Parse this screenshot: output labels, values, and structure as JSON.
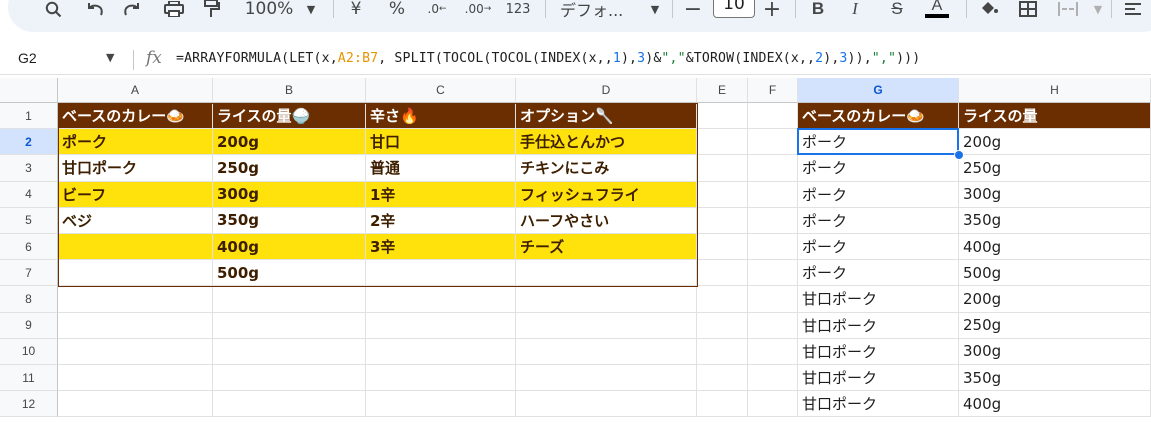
{
  "toolbar": {
    "zoom": "100%",
    "currency": "¥",
    "percent": "%",
    "decrease_decimals": ".0",
    "increase_decimals": ".00",
    "number_format": "123",
    "font_name": "デフォ...",
    "font_size": "10",
    "minus": "−",
    "plus": "+",
    "bold": "B",
    "italic": "I",
    "strikethrough": "S",
    "text_color": "A"
  },
  "formula_bar": {
    "cell_ref": "G2",
    "fx": "fx",
    "formula_parts": [
      {
        "text": "=ARRAYFORMULA(LET(x,",
        "kind": "plain"
      },
      {
        "text": "A2:B7",
        "kind": "ref"
      },
      {
        "text": ", SPLIT(TOCOL(TOCOL(INDEX(x,,",
        "kind": "plain"
      },
      {
        "text": "1",
        "kind": "num"
      },
      {
        "text": "),",
        "kind": "plain"
      },
      {
        "text": "3",
        "kind": "num"
      },
      {
        "text": ")&",
        "kind": "plain"
      },
      {
        "text": "\",\"",
        "kind": "str"
      },
      {
        "text": "&TOROW(INDEX(x,,",
        "kind": "plain"
      },
      {
        "text": "2",
        "kind": "num"
      },
      {
        "text": "),",
        "kind": "plain"
      },
      {
        "text": "3",
        "kind": "num"
      },
      {
        "text": ")),",
        "kind": "plain"
      },
      {
        "text": "\",\"",
        "kind": "str"
      },
      {
        "text": ")))",
        "kind": "plain"
      }
    ]
  },
  "columns": [
    "A",
    "B",
    "C",
    "D",
    "E",
    "F",
    "G",
    "H"
  ],
  "selected_column": "G",
  "rows": [
    "1",
    "2",
    "3",
    "4",
    "5",
    "6",
    "7",
    "8",
    "9",
    "10",
    "11",
    "12"
  ],
  "selected_row": "2",
  "table": {
    "headers": [
      "ベースのカレー🍛",
      "ライスの量🍚",
      "辛さ🔥",
      "オプション🥄"
    ],
    "rows": [
      [
        "ポーク",
        "200g",
        "甘口",
        "手仕込とんかつ"
      ],
      [
        "甘口ポーク",
        "250g",
        "普通",
        "チキンにこみ"
      ],
      [
        "ビーフ",
        "300g",
        "1辛",
        "フィッシュフライ"
      ],
      [
        "ベジ",
        "350g",
        "2辛",
        "ハーフやさい"
      ],
      [
        "",
        "400g",
        "3辛",
        "チーズ"
      ],
      [
        "",
        "500g",
        "",
        ""
      ]
    ]
  },
  "output": {
    "headers": [
      "ベースのカレー🍛",
      "ライスの量"
    ],
    "rows": [
      [
        "ポーク",
        "200g"
      ],
      [
        "ポーク",
        "250g"
      ],
      [
        "ポーク",
        "300g"
      ],
      [
        "ポーク",
        "350g"
      ],
      [
        "ポーク",
        "400g"
      ],
      [
        "ポーク",
        "500g"
      ],
      [
        "甘口ポーク",
        "200g"
      ],
      [
        "甘口ポーク",
        "250g"
      ],
      [
        "甘口ポーク",
        "300g"
      ],
      [
        "甘口ポーク",
        "350g"
      ],
      [
        "甘口ポーク",
        "400g"
      ]
    ]
  },
  "colors": {
    "header_bg": "#6a2e00",
    "band_yellow": "#ffe10c",
    "selection_blue": "#1a73e8"
  }
}
